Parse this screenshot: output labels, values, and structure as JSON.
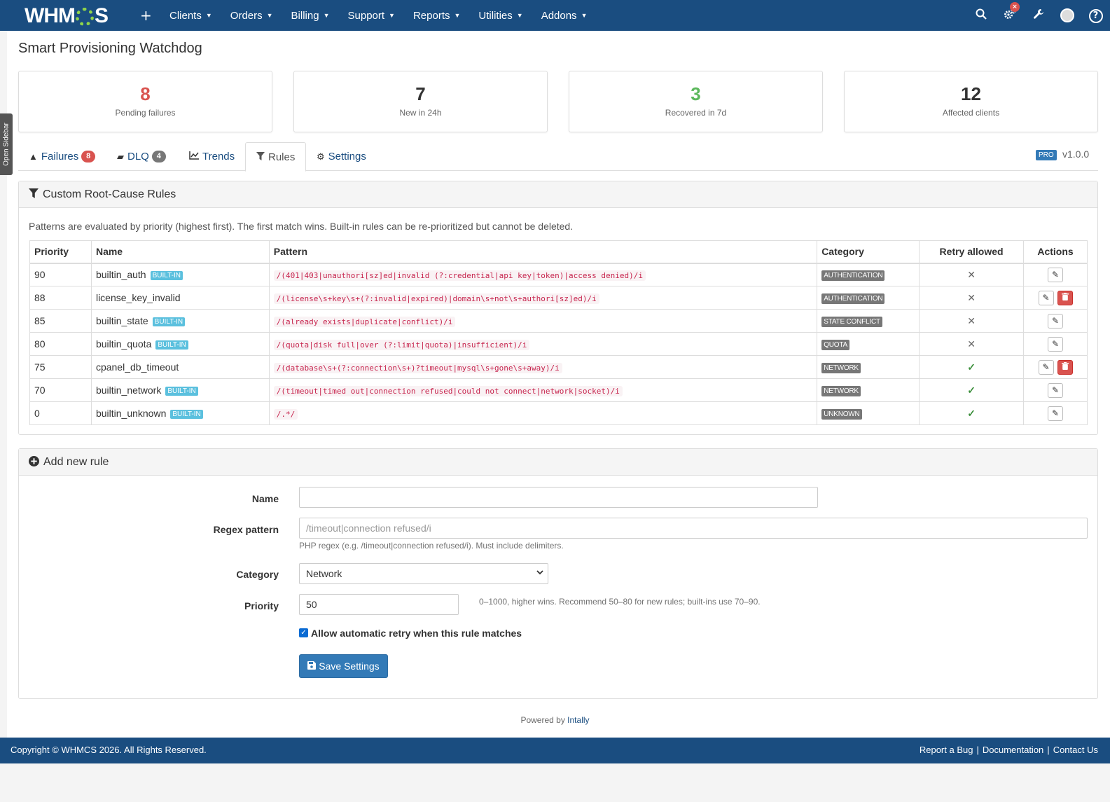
{
  "nav": {
    "logo": "WHMCS",
    "plus": "+",
    "menu": [
      "Clients",
      "Orders",
      "Billing",
      "Support",
      "Reports",
      "Utilities",
      "Addons"
    ],
    "notification_badge": "×",
    "icons": [
      "search-icon",
      "cogs-icon",
      "wrench-icon",
      "avatar",
      "help-icon"
    ]
  },
  "sidebar_toggle": "Open Sidebar",
  "page_title": "Smart Provisioning Watchdog",
  "stats": [
    {
      "value": "8",
      "label": "Pending failures",
      "color": "#d9534f"
    },
    {
      "value": "7",
      "label": "New in 24h",
      "color": "#333333"
    },
    {
      "value": "3",
      "label": "Recovered in 7d",
      "color": "#5cb85c"
    },
    {
      "value": "12",
      "label": "Affected clients",
      "color": "#333333"
    }
  ],
  "tabs": [
    {
      "label": "Failures",
      "count": "8",
      "count_color": "#d9534f"
    },
    {
      "label": "DLQ",
      "count": "4",
      "count_color": "#777777"
    },
    {
      "label": "Trends"
    },
    {
      "label": "Rules"
    },
    {
      "label": "Settings"
    }
  ],
  "pro_label": "PRO",
  "version": "v1.0.0",
  "rules_panel": {
    "title": "Custom Root-Cause Rules",
    "description": "Patterns are evaluated by priority (highest first). The first match wins. Built-in rules can be re-prioritized but cannot be deleted.",
    "columns": [
      "Priority",
      "Name",
      "Pattern",
      "Category",
      "Retry allowed",
      "Actions"
    ],
    "builtin_label": "BUILT-IN",
    "rows": [
      {
        "priority": "90",
        "name": "builtin_auth",
        "builtin": true,
        "pattern": "/(401|403|unauthori[sz]ed|invalid (?:credential|api key|token)|access denied)/i",
        "category": "AUTHENTICATION",
        "retry": false
      },
      {
        "priority": "88",
        "name": "license_key_invalid",
        "builtin": false,
        "pattern": "/(license\\s+key\\s+(?:invalid|expired)|domain\\s+not\\s+authori[sz]ed)/i",
        "category": "AUTHENTICATION",
        "retry": false
      },
      {
        "priority": "85",
        "name": "builtin_state",
        "builtin": true,
        "pattern": "/(already exists|duplicate|conflict)/i",
        "category": "STATE CONFLICT",
        "retry": false
      },
      {
        "priority": "80",
        "name": "builtin_quota",
        "builtin": true,
        "pattern": "/(quota|disk full|over (?:limit|quota)|insufficient)/i",
        "category": "QUOTA",
        "retry": false
      },
      {
        "priority": "75",
        "name": "cpanel_db_timeout",
        "builtin": false,
        "pattern": "/(database\\s+(?:connection\\s+)?timeout|mysql\\s+gone\\s+away)/i",
        "category": "NETWORK",
        "retry": true
      },
      {
        "priority": "70",
        "name": "builtin_network",
        "builtin": true,
        "pattern": "/(timeout|timed out|connection refused|could not connect|network|socket)/i",
        "category": "NETWORK",
        "retry": true
      },
      {
        "priority": "0",
        "name": "builtin_unknown",
        "builtin": true,
        "pattern": "/.*/",
        "category": "UNKNOWN",
        "retry": true
      }
    ]
  },
  "add_panel": {
    "title": "Add new rule",
    "name_label": "Name",
    "name_value": "",
    "regex_label": "Regex pattern",
    "regex_placeholder": "/timeout|connection refused/i",
    "regex_help": "PHP regex (e.g. /timeout|connection refused/i). Must include delimiters.",
    "category_label": "Category",
    "category_value": "Network",
    "priority_label": "Priority",
    "priority_value": "50",
    "priority_help": "0–1000, higher wins. Recommend 50–80 for new rules; built-ins use 70–90.",
    "retry_label": "Allow automatic retry when this rule matches",
    "retry_checked": true,
    "save_label": "Save Settings"
  },
  "powered_by": "Powered by",
  "powered_link": "Intally",
  "footer": {
    "copyright": "Copyright © WHMCS 2026. All Rights Reserved.",
    "links": [
      "Report a Bug",
      "Documentation",
      "Contact Us"
    ]
  }
}
